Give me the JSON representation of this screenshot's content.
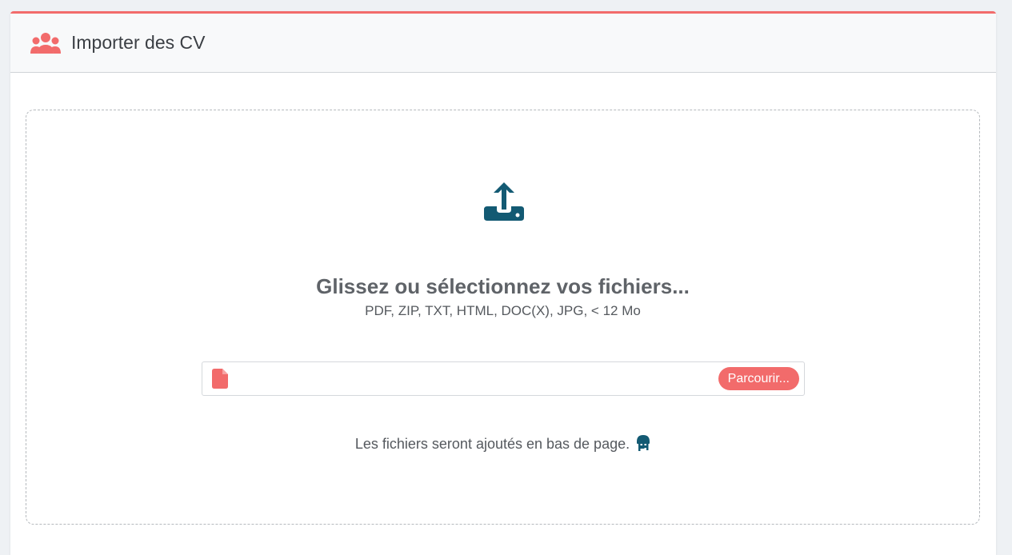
{
  "header": {
    "title": "Importer des CV",
    "icon": "users-icon"
  },
  "dropzone": {
    "icon": "upload-icon",
    "heading": "Glissez ou sélectionnez vos fichiers...",
    "formats": "PDF, ZIP, TXT, HTML, DOC(X), JPG, < 12 Mo",
    "file_input": {
      "icon": "file-icon",
      "value": "",
      "browse_label": "Parcourir..."
    },
    "note": "Les fichiers seront ajoutés en bas de page.",
    "note_icon": "info-icon"
  },
  "colors": {
    "accent": "#f26b6b",
    "icon_dark": "#135a73",
    "text": "#5f6368"
  }
}
